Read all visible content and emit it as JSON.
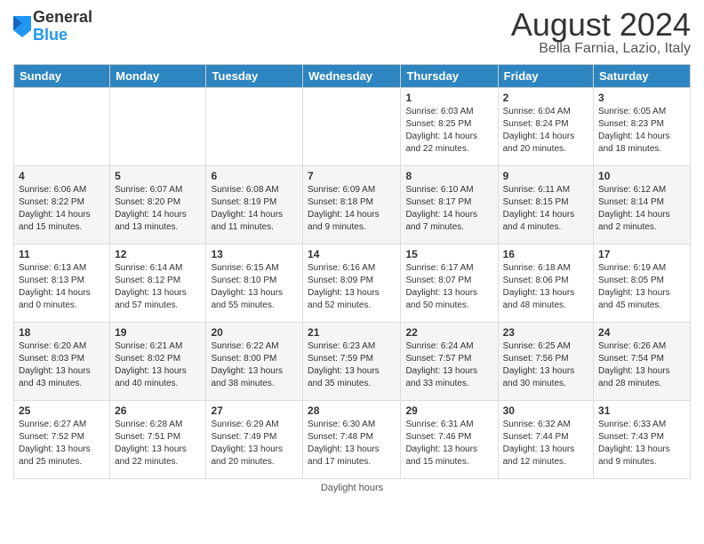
{
  "header": {
    "logo_line1": "General",
    "logo_line2": "Blue",
    "month_year": "August 2024",
    "location": "Bella Farnia, Lazio, Italy"
  },
  "weekdays": [
    "Sunday",
    "Monday",
    "Tuesday",
    "Wednesday",
    "Thursday",
    "Friday",
    "Saturday"
  ],
  "weeks": [
    [
      {
        "day": "",
        "info": ""
      },
      {
        "day": "",
        "info": ""
      },
      {
        "day": "",
        "info": ""
      },
      {
        "day": "",
        "info": ""
      },
      {
        "day": "1",
        "info": "Sunrise: 6:03 AM\nSunset: 8:25 PM\nDaylight: 14 hours\nand 22 minutes."
      },
      {
        "day": "2",
        "info": "Sunrise: 6:04 AM\nSunset: 8:24 PM\nDaylight: 14 hours\nand 20 minutes."
      },
      {
        "day": "3",
        "info": "Sunrise: 6:05 AM\nSunset: 8:23 PM\nDaylight: 14 hours\nand 18 minutes."
      }
    ],
    [
      {
        "day": "4",
        "info": "Sunrise: 6:06 AM\nSunset: 8:22 PM\nDaylight: 14 hours\nand 15 minutes."
      },
      {
        "day": "5",
        "info": "Sunrise: 6:07 AM\nSunset: 8:20 PM\nDaylight: 14 hours\nand 13 minutes."
      },
      {
        "day": "6",
        "info": "Sunrise: 6:08 AM\nSunset: 8:19 PM\nDaylight: 14 hours\nand 11 minutes."
      },
      {
        "day": "7",
        "info": "Sunrise: 6:09 AM\nSunset: 8:18 PM\nDaylight: 14 hours\nand 9 minutes."
      },
      {
        "day": "8",
        "info": "Sunrise: 6:10 AM\nSunset: 8:17 PM\nDaylight: 14 hours\nand 7 minutes."
      },
      {
        "day": "9",
        "info": "Sunrise: 6:11 AM\nSunset: 8:15 PM\nDaylight: 14 hours\nand 4 minutes."
      },
      {
        "day": "10",
        "info": "Sunrise: 6:12 AM\nSunset: 8:14 PM\nDaylight: 14 hours\nand 2 minutes."
      }
    ],
    [
      {
        "day": "11",
        "info": "Sunrise: 6:13 AM\nSunset: 8:13 PM\nDaylight: 14 hours\nand 0 minutes."
      },
      {
        "day": "12",
        "info": "Sunrise: 6:14 AM\nSunset: 8:12 PM\nDaylight: 13 hours\nand 57 minutes."
      },
      {
        "day": "13",
        "info": "Sunrise: 6:15 AM\nSunset: 8:10 PM\nDaylight: 13 hours\nand 55 minutes."
      },
      {
        "day": "14",
        "info": "Sunrise: 6:16 AM\nSunset: 8:09 PM\nDaylight: 13 hours\nand 52 minutes."
      },
      {
        "day": "15",
        "info": "Sunrise: 6:17 AM\nSunset: 8:07 PM\nDaylight: 13 hours\nand 50 minutes."
      },
      {
        "day": "16",
        "info": "Sunrise: 6:18 AM\nSunset: 8:06 PM\nDaylight: 13 hours\nand 48 minutes."
      },
      {
        "day": "17",
        "info": "Sunrise: 6:19 AM\nSunset: 8:05 PM\nDaylight: 13 hours\nand 45 minutes."
      }
    ],
    [
      {
        "day": "18",
        "info": "Sunrise: 6:20 AM\nSunset: 8:03 PM\nDaylight: 13 hours\nand 43 minutes."
      },
      {
        "day": "19",
        "info": "Sunrise: 6:21 AM\nSunset: 8:02 PM\nDaylight: 13 hours\nand 40 minutes."
      },
      {
        "day": "20",
        "info": "Sunrise: 6:22 AM\nSunset: 8:00 PM\nDaylight: 13 hours\nand 38 minutes."
      },
      {
        "day": "21",
        "info": "Sunrise: 6:23 AM\nSunset: 7:59 PM\nDaylight: 13 hours\nand 35 minutes."
      },
      {
        "day": "22",
        "info": "Sunrise: 6:24 AM\nSunset: 7:57 PM\nDaylight: 13 hours\nand 33 minutes."
      },
      {
        "day": "23",
        "info": "Sunrise: 6:25 AM\nSunset: 7:56 PM\nDaylight: 13 hours\nand 30 minutes."
      },
      {
        "day": "24",
        "info": "Sunrise: 6:26 AM\nSunset: 7:54 PM\nDaylight: 13 hours\nand 28 minutes."
      }
    ],
    [
      {
        "day": "25",
        "info": "Sunrise: 6:27 AM\nSunset: 7:52 PM\nDaylight: 13 hours\nand 25 minutes."
      },
      {
        "day": "26",
        "info": "Sunrise: 6:28 AM\nSunset: 7:51 PM\nDaylight: 13 hours\nand 22 minutes."
      },
      {
        "day": "27",
        "info": "Sunrise: 6:29 AM\nSunset: 7:49 PM\nDaylight: 13 hours\nand 20 minutes."
      },
      {
        "day": "28",
        "info": "Sunrise: 6:30 AM\nSunset: 7:48 PM\nDaylight: 13 hours\nand 17 minutes."
      },
      {
        "day": "29",
        "info": "Sunrise: 6:31 AM\nSunset: 7:46 PM\nDaylight: 13 hours\nand 15 minutes."
      },
      {
        "day": "30",
        "info": "Sunrise: 6:32 AM\nSunset: 7:44 PM\nDaylight: 13 hours\nand 12 minutes."
      },
      {
        "day": "31",
        "info": "Sunrise: 6:33 AM\nSunset: 7:43 PM\nDaylight: 13 hours\nand 9 minutes."
      }
    ]
  ],
  "footer": "Daylight hours"
}
